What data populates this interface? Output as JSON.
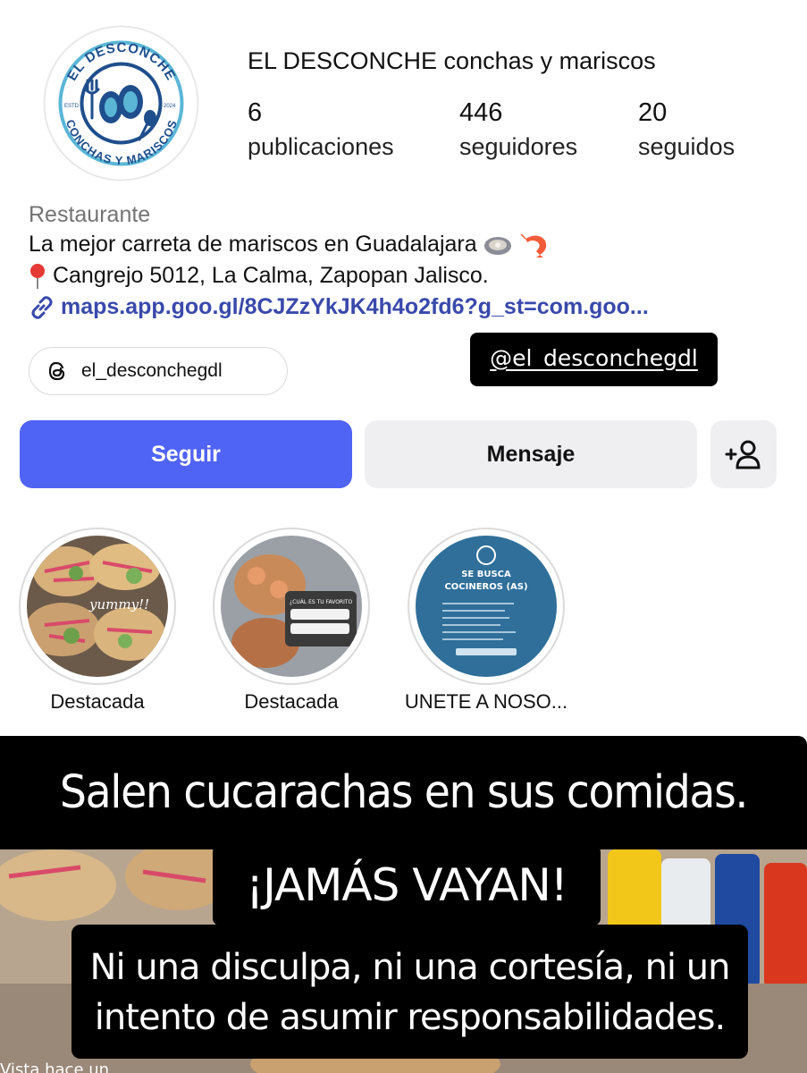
{
  "profile": {
    "username": "EL DESCONCHE conchas y mariscos",
    "logo": {
      "top_text": "EL DESCONCHE",
      "bottom_text": "CONCHAS Y MARISCOS",
      "left_small": "ESTD",
      "right_small": "2024"
    },
    "stats": [
      {
        "value": "6",
        "label": "publicaciones"
      },
      {
        "value": "446",
        "label": "seguidores"
      },
      {
        "value": "20",
        "label": "seguidos"
      }
    ],
    "category": "Restaurante",
    "bio_line": "La mejor carreta de mariscos en Guadalajara",
    "address": "Cangrejo 5012, La Calma, Zapopan Jalisco.",
    "link": "maps.app.goo.gl/8CJZzYkJK4h4o2fd6?g_st=com.goo...",
    "threads_handle": "el_desconchegdl"
  },
  "actions": {
    "follow": "Seguir",
    "message": "Mensaje"
  },
  "highlights": [
    {
      "label": "Destacada",
      "overlay_text": "yummy!!"
    },
    {
      "label": "Destacada",
      "overlay_text": "¿CUÁL ES TU FAVORITO"
    },
    {
      "label": "UNETE A NOSO...",
      "overlay_title": "SE BUSCA COCINEROS (AS)"
    }
  ],
  "story": {
    "mention_sticker": "@el_desconchegdl",
    "caption_1": "Salen cucarachas en sus comidas.",
    "caption_2": "¡JAMÁS VAYAN!",
    "caption_3_line1": "Ni una disculpa, ni una cortesía,  ni un",
    "caption_3_line2": "intento de asumir responsabilidades.",
    "cut_text": "Vista hace un"
  },
  "colors": {
    "follow_button": "#4f63f5",
    "secondary_button": "#efeff2",
    "link": "#3949ab",
    "caption_bg": "#000000",
    "logo_blue": "#1f4e8c",
    "logo_ring": "#5bb6d6"
  },
  "icons": [
    "threads-icon",
    "link-icon",
    "add-person-icon",
    "location-pin-icon",
    "oyster-emoji",
    "shrimp-emoji"
  ]
}
